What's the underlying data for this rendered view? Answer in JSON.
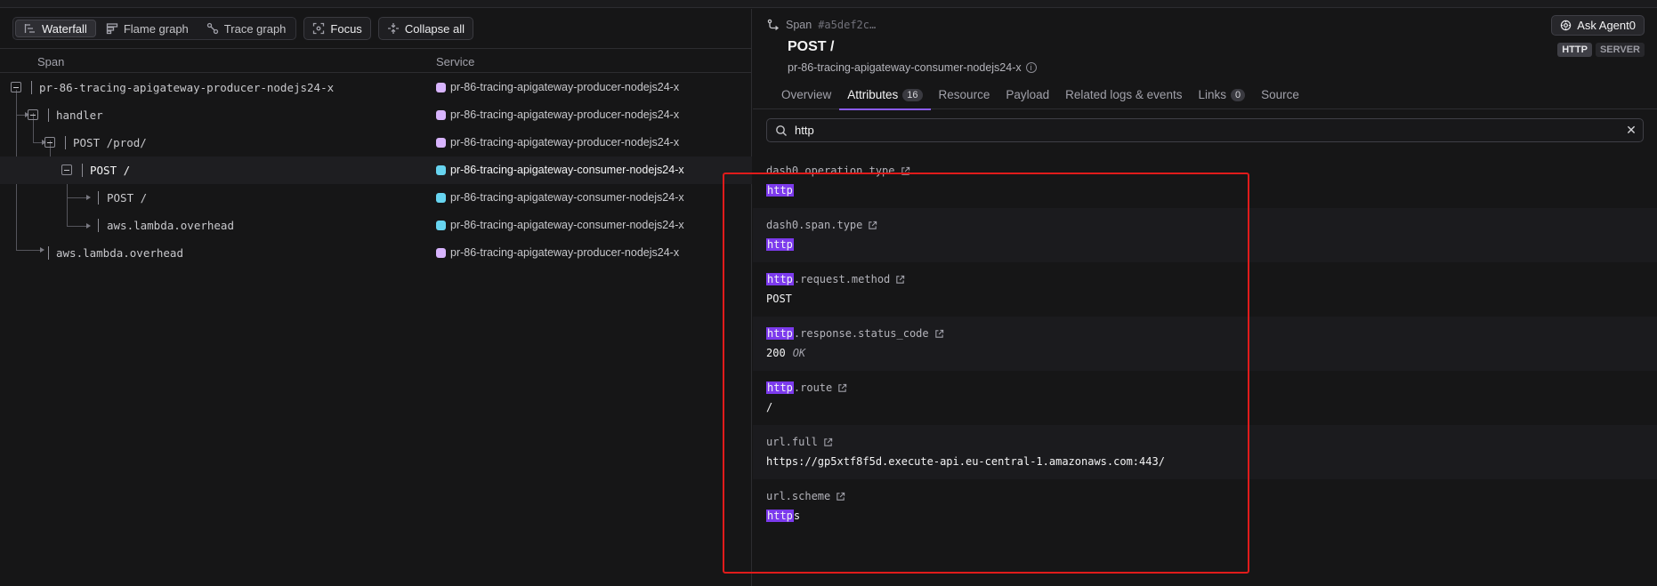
{
  "toolbar": {
    "waterfall": "Waterfall",
    "flame_graph": "Flame graph",
    "trace_graph": "Trace graph",
    "focus": "Focus",
    "collapse_all": "Collapse all"
  },
  "table": {
    "col_span": "Span",
    "col_service": "Service",
    "rows": [
      {
        "name": "pr-86-tracing-apigateway-producer-nodejs24-x",
        "service": "pr-86-tracing-apigateway-producer-nodejs24-x",
        "service_color": "#d8b4fe"
      },
      {
        "name": "handler",
        "service": "pr-86-tracing-apigateway-producer-nodejs24-x",
        "service_color": "#d8b4fe"
      },
      {
        "name": "POST /prod/",
        "service": "pr-86-tracing-apigateway-producer-nodejs24-x",
        "service_color": "#d8b4fe"
      },
      {
        "name": "POST /",
        "service": "pr-86-tracing-apigateway-consumer-nodejs24-x",
        "service_color": "#67d4f0"
      },
      {
        "name": "POST /",
        "service": "pr-86-tracing-apigateway-consumer-nodejs24-x",
        "service_color": "#67d4f0"
      },
      {
        "name": "aws.lambda.overhead",
        "service": "pr-86-tracing-apigateway-consumer-nodejs24-x",
        "service_color": "#67d4f0"
      },
      {
        "name": "aws.lambda.overhead",
        "service": "pr-86-tracing-apigateway-producer-nodejs24-x",
        "service_color": "#d8b4fe"
      }
    ]
  },
  "detail": {
    "span_label": "Span",
    "span_id": "#a5def2c…",
    "title": "POST /",
    "service": "pr-86-tracing-apigateway-consumer-nodejs24-x",
    "ask_button": "Ask Agent0",
    "badge_http": "HTTP",
    "badge_server": "SERVER",
    "tabs": {
      "overview": "Overview",
      "attributes": "Attributes",
      "attributes_count": "16",
      "resource": "Resource",
      "payload": "Payload",
      "related": "Related logs & events",
      "links": "Links",
      "links_count": "0",
      "source": "Source"
    },
    "search_value": "http",
    "attributes": [
      {
        "key_pre": "",
        "key_hl": "",
        "key_post": "dash0.operation.type",
        "val_pre": "",
        "val_hl": "http",
        "val_post": ""
      },
      {
        "key_pre": "",
        "key_hl": "",
        "key_post": "dash0.span.type",
        "val_pre": "",
        "val_hl": "http",
        "val_post": ""
      },
      {
        "key_pre": "",
        "key_hl": "http",
        "key_post": ".request.method",
        "val_pre": "POST",
        "val_hl": "",
        "val_post": ""
      },
      {
        "key_pre": "",
        "key_hl": "http",
        "key_post": ".response.status_code",
        "val_pre": "200",
        "val_hl": "",
        "val_post": "",
        "val_extra": "OK"
      },
      {
        "key_pre": "",
        "key_hl": "http",
        "key_post": ".route",
        "val_pre": "/",
        "val_hl": "",
        "val_post": ""
      },
      {
        "key_pre": "",
        "key_hl": "",
        "key_post": "url.full",
        "val_pre": "https://gp5xtf8f5d.execute-api.eu-central-1.amazonaws.com:443/",
        "val_hl": "",
        "val_post": ""
      },
      {
        "key_pre": "",
        "key_hl": "",
        "key_post": "url.scheme",
        "val_pre": "",
        "val_hl": "http",
        "val_post": "s"
      }
    ]
  },
  "colors": {
    "accent": "#8b5cf6",
    "highlight": "#7c3aed",
    "annotation_red": "#e01b1b"
  }
}
